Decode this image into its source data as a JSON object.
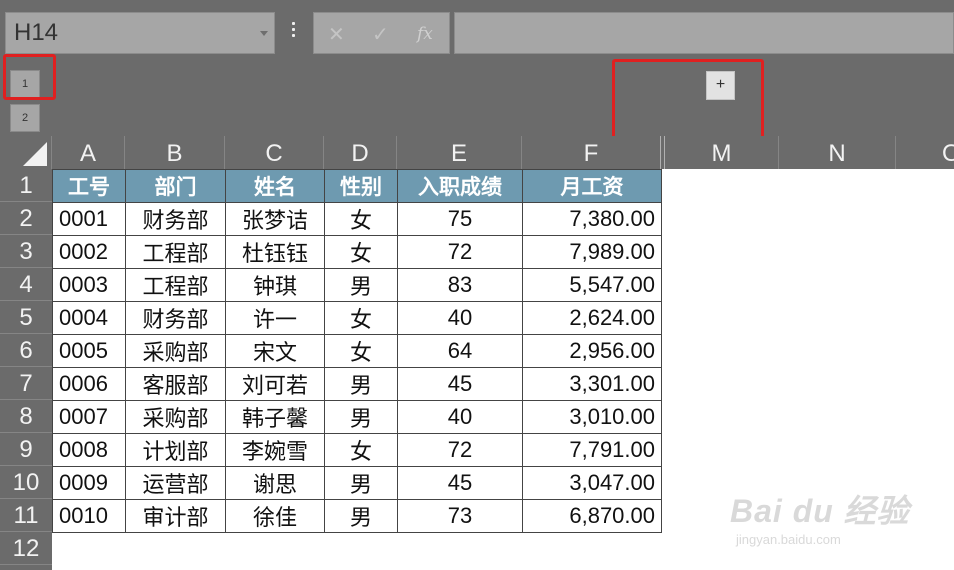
{
  "name_box": {
    "value": "H14"
  },
  "formula_bar": {
    "cancel_icon": "✕",
    "enter_icon": "✓",
    "fx_label": "fx",
    "content": ""
  },
  "outline": {
    "level1": "1",
    "level2": "2",
    "expand": "+"
  },
  "columns": [
    "A",
    "B",
    "C",
    "D",
    "E",
    "F",
    "M",
    "N",
    "O"
  ],
  "rows": [
    "1",
    "2",
    "3",
    "4",
    "5",
    "6",
    "7",
    "8",
    "9",
    "10",
    "11",
    "12"
  ],
  "table": {
    "headers": [
      "工号",
      "部门",
      "姓名",
      "性别",
      "入职成绩",
      "月工资"
    ],
    "rows": [
      [
        "0001",
        "财务部",
        "张梦诘",
        "女",
        "75",
        "7,380.00"
      ],
      [
        "0002",
        "工程部",
        "杜钰钰",
        "女",
        "72",
        "7,989.00"
      ],
      [
        "0003",
        "工程部",
        "钟琪",
        "男",
        "83",
        "5,547.00"
      ],
      [
        "0004",
        "财务部",
        "许一",
        "女",
        "40",
        "2,624.00"
      ],
      [
        "0005",
        "采购部",
        "宋文",
        "女",
        "64",
        "2,956.00"
      ],
      [
        "0006",
        "客服部",
        "刘可若",
        "男",
        "45",
        "3,301.00"
      ],
      [
        "0007",
        "采购部",
        "韩子馨",
        "男",
        "40",
        "3,010.00"
      ],
      [
        "0008",
        "计划部",
        "李婉雪",
        "女",
        "72",
        "7,791.00"
      ],
      [
        "0009",
        "运营部",
        "谢思",
        "男",
        "45",
        "3,047.00"
      ],
      [
        "0010",
        "审计部",
        "徐佳",
        "男",
        "73",
        "6,870.00"
      ]
    ]
  },
  "watermark": {
    "brand": "Bai du 经验",
    "url": "jingyan.baidu.com"
  },
  "colors": {
    "header_fill": "#6e9ab0",
    "highlight": "#e02020",
    "chrome": "#6b6b6b"
  }
}
